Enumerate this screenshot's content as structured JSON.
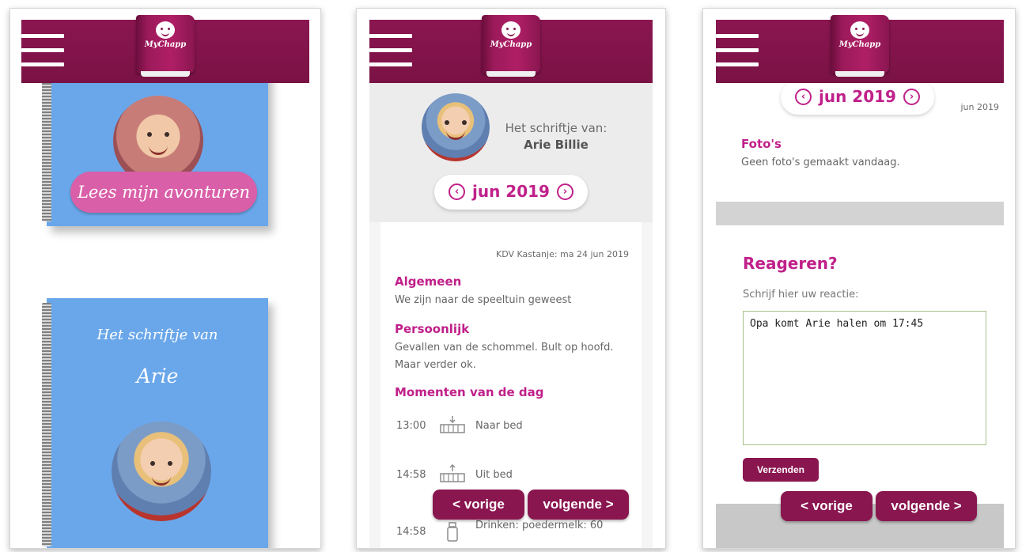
{
  "app": {
    "logo_text": "MyChapp"
  },
  "panel1": {
    "read_button": "Lees mijn avonturen",
    "notebook_title": "Het schriftje van",
    "notebook_name": "Arie"
  },
  "panel2": {
    "profile_label": "Het schriftje van:",
    "profile_name": "Arie Billie",
    "month": "jun 2019",
    "entry_stamp": "KDV Kastanje: ma 24 jun 2019",
    "sections": {
      "algemeen_title": "Algemeen",
      "algemeen_text": "We zijn naar de speeltuin geweest",
      "persoonlijk_title": "Persoonlijk",
      "persoonlijk_text": "Gevallen van de schommel. Bult op hoofd. Maar verder ok.",
      "momenten_title": "Momenten van de dag"
    },
    "moments": [
      {
        "time": "13:00",
        "text": "Naar bed",
        "icon": "bed-down-icon"
      },
      {
        "time": "14:58",
        "text": "Uit bed",
        "icon": "bed-up-icon"
      },
      {
        "time": "14:58",
        "text": "Drinken: poedermelk: 60",
        "icon": "bottle-icon"
      }
    ],
    "prev_label": "< vorige",
    "next_label": "volgende >"
  },
  "panel3": {
    "month": "jun 2019",
    "stamp": "jun 2019",
    "photos_title": "Foto's",
    "photos_text": "Geen foto's gemaakt vandaag.",
    "react_title": "Reageren?",
    "react_label": "Schrijf hier uw reactie:",
    "react_value": "Opa komt Arie halen om 17:45",
    "send_label": "Verzenden",
    "prev_label": "< vorige",
    "next_label": "volgende >"
  },
  "colors": {
    "brand": "#8a1650",
    "accent": "#c0208a",
    "notebook": "#6aa7ea",
    "pill_button": "#d95fa8"
  }
}
